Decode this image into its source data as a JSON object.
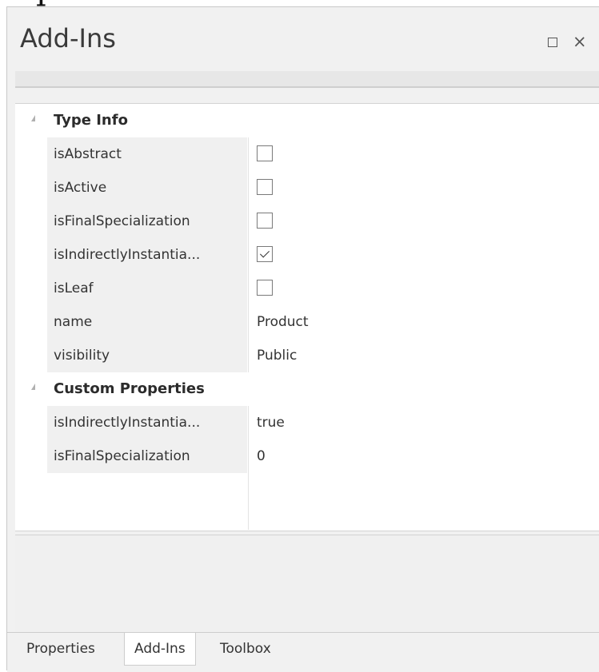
{
  "clipped_heading": "rap",
  "panel": {
    "title": "Add-Ins"
  },
  "window_controls": {
    "maximize_glyph": "",
    "close_glyph": "×"
  },
  "sections": [
    {
      "label": "Type Info",
      "rows": [
        {
          "name": "isAbstract",
          "type": "checkbox",
          "checked": false
        },
        {
          "name": "isActive",
          "type": "checkbox",
          "checked": false
        },
        {
          "name": "isFinalSpecialization",
          "type": "checkbox",
          "checked": false
        },
        {
          "name": "isIndirectlyInstantia...",
          "type": "checkbox",
          "checked": true
        },
        {
          "name": "isLeaf",
          "type": "checkbox",
          "checked": false
        },
        {
          "name": "name",
          "type": "text",
          "value": "Product"
        },
        {
          "name": "visibility",
          "type": "text",
          "value": "Public"
        }
      ]
    },
    {
      "label": "Custom Properties",
      "rows": [
        {
          "name": "isIndirectlyInstantia...",
          "type": "text",
          "value": "true"
        },
        {
          "name": "isFinalSpecialization",
          "type": "text",
          "value": "0"
        }
      ]
    }
  ],
  "tabs": [
    {
      "label": "Properties",
      "active": false
    },
    {
      "label": "Add-Ins",
      "active": true
    },
    {
      "label": "Toolbox",
      "active": false
    }
  ]
}
